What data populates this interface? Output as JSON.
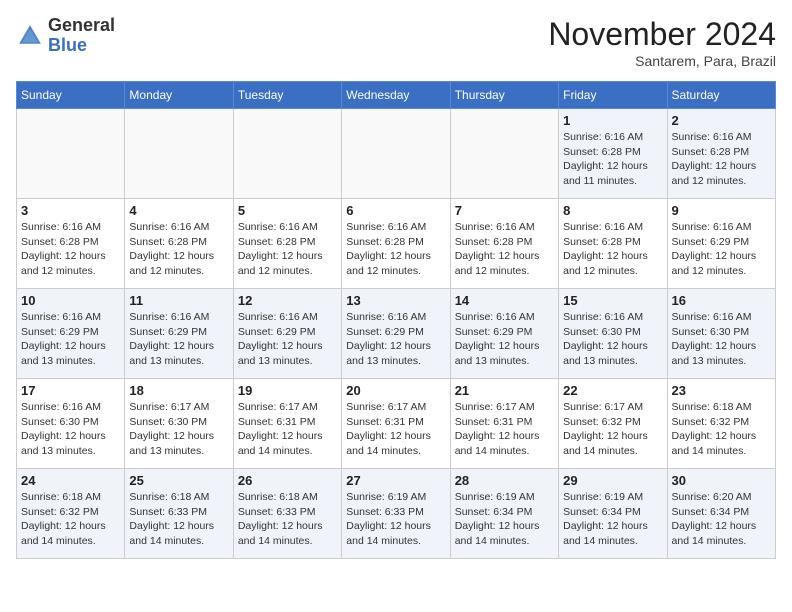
{
  "header": {
    "logo_general": "General",
    "logo_blue": "Blue",
    "month_title": "November 2024",
    "subtitle": "Santarem, Para, Brazil"
  },
  "days_of_week": [
    "Sunday",
    "Monday",
    "Tuesday",
    "Wednesday",
    "Thursday",
    "Friday",
    "Saturday"
  ],
  "weeks": [
    [
      {
        "day": "",
        "info": ""
      },
      {
        "day": "",
        "info": ""
      },
      {
        "day": "",
        "info": ""
      },
      {
        "day": "",
        "info": ""
      },
      {
        "day": "",
        "info": ""
      },
      {
        "day": "1",
        "info": "Sunrise: 6:16 AM\nSunset: 6:28 PM\nDaylight: 12 hours\nand 11 minutes."
      },
      {
        "day": "2",
        "info": "Sunrise: 6:16 AM\nSunset: 6:28 PM\nDaylight: 12 hours\nand 12 minutes."
      }
    ],
    [
      {
        "day": "3",
        "info": "Sunrise: 6:16 AM\nSunset: 6:28 PM\nDaylight: 12 hours\nand 12 minutes."
      },
      {
        "day": "4",
        "info": "Sunrise: 6:16 AM\nSunset: 6:28 PM\nDaylight: 12 hours\nand 12 minutes."
      },
      {
        "day": "5",
        "info": "Sunrise: 6:16 AM\nSunset: 6:28 PM\nDaylight: 12 hours\nand 12 minutes."
      },
      {
        "day": "6",
        "info": "Sunrise: 6:16 AM\nSunset: 6:28 PM\nDaylight: 12 hours\nand 12 minutes."
      },
      {
        "day": "7",
        "info": "Sunrise: 6:16 AM\nSunset: 6:28 PM\nDaylight: 12 hours\nand 12 minutes."
      },
      {
        "day": "8",
        "info": "Sunrise: 6:16 AM\nSunset: 6:28 PM\nDaylight: 12 hours\nand 12 minutes."
      },
      {
        "day": "9",
        "info": "Sunrise: 6:16 AM\nSunset: 6:29 PM\nDaylight: 12 hours\nand 12 minutes."
      }
    ],
    [
      {
        "day": "10",
        "info": "Sunrise: 6:16 AM\nSunset: 6:29 PM\nDaylight: 12 hours\nand 13 minutes."
      },
      {
        "day": "11",
        "info": "Sunrise: 6:16 AM\nSunset: 6:29 PM\nDaylight: 12 hours\nand 13 minutes."
      },
      {
        "day": "12",
        "info": "Sunrise: 6:16 AM\nSunset: 6:29 PM\nDaylight: 12 hours\nand 13 minutes."
      },
      {
        "day": "13",
        "info": "Sunrise: 6:16 AM\nSunset: 6:29 PM\nDaylight: 12 hours\nand 13 minutes."
      },
      {
        "day": "14",
        "info": "Sunrise: 6:16 AM\nSunset: 6:29 PM\nDaylight: 12 hours\nand 13 minutes."
      },
      {
        "day": "15",
        "info": "Sunrise: 6:16 AM\nSunset: 6:30 PM\nDaylight: 12 hours\nand 13 minutes."
      },
      {
        "day": "16",
        "info": "Sunrise: 6:16 AM\nSunset: 6:30 PM\nDaylight: 12 hours\nand 13 minutes."
      }
    ],
    [
      {
        "day": "17",
        "info": "Sunrise: 6:16 AM\nSunset: 6:30 PM\nDaylight: 12 hours\nand 13 minutes."
      },
      {
        "day": "18",
        "info": "Sunrise: 6:17 AM\nSunset: 6:30 PM\nDaylight: 12 hours\nand 13 minutes."
      },
      {
        "day": "19",
        "info": "Sunrise: 6:17 AM\nSunset: 6:31 PM\nDaylight: 12 hours\nand 14 minutes."
      },
      {
        "day": "20",
        "info": "Sunrise: 6:17 AM\nSunset: 6:31 PM\nDaylight: 12 hours\nand 14 minutes."
      },
      {
        "day": "21",
        "info": "Sunrise: 6:17 AM\nSunset: 6:31 PM\nDaylight: 12 hours\nand 14 minutes."
      },
      {
        "day": "22",
        "info": "Sunrise: 6:17 AM\nSunset: 6:32 PM\nDaylight: 12 hours\nand 14 minutes."
      },
      {
        "day": "23",
        "info": "Sunrise: 6:18 AM\nSunset: 6:32 PM\nDaylight: 12 hours\nand 14 minutes."
      }
    ],
    [
      {
        "day": "24",
        "info": "Sunrise: 6:18 AM\nSunset: 6:32 PM\nDaylight: 12 hours\nand 14 minutes."
      },
      {
        "day": "25",
        "info": "Sunrise: 6:18 AM\nSunset: 6:33 PM\nDaylight: 12 hours\nand 14 minutes."
      },
      {
        "day": "26",
        "info": "Sunrise: 6:18 AM\nSunset: 6:33 PM\nDaylight: 12 hours\nand 14 minutes."
      },
      {
        "day": "27",
        "info": "Sunrise: 6:19 AM\nSunset: 6:33 PM\nDaylight: 12 hours\nand 14 minutes."
      },
      {
        "day": "28",
        "info": "Sunrise: 6:19 AM\nSunset: 6:34 PM\nDaylight: 12 hours\nand 14 minutes."
      },
      {
        "day": "29",
        "info": "Sunrise: 6:19 AM\nSunset: 6:34 PM\nDaylight: 12 hours\nand 14 minutes."
      },
      {
        "day": "30",
        "info": "Sunrise: 6:20 AM\nSunset: 6:34 PM\nDaylight: 12 hours\nand 14 minutes."
      }
    ]
  ]
}
